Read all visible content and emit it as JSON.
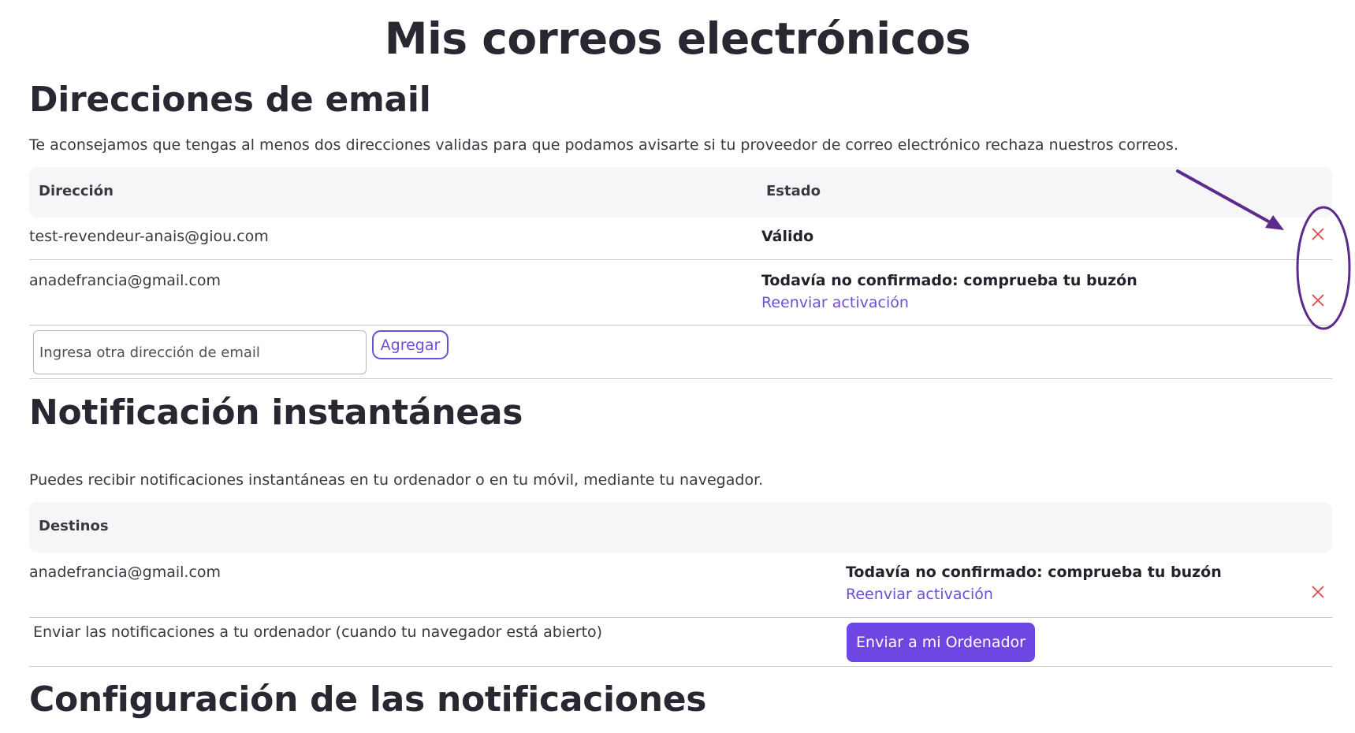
{
  "page_title": "Mis correos electrónicos",
  "emails_section": {
    "heading": "Direcciones de email",
    "description": "Te aconsejamos que tengas al menos dos direcciones validas para que podamos avisarte si tu proveedor de correo electrónico rechaza nuestros correos.",
    "columns": {
      "address": "Dirección",
      "status": "Estado"
    },
    "rows": [
      {
        "address": "test-revendeur-anais@giou.com",
        "status": "Válido"
      },
      {
        "address": "anadefrancia@gmail.com",
        "status": "Todavía no confirmado: comprueba tu buzón",
        "resend": "Reenviar activación"
      }
    ],
    "input_placeholder": "Ingresa otra dirección de email",
    "add_button": "Agregar"
  },
  "push_section": {
    "heading": "Notificación instantáneas",
    "description": "Puedes recibir notificaciones instantáneas en tu ordenador o en tu móvil, mediante tu navegador.",
    "column": "Destinos",
    "rows": [
      {
        "destination": "anadefrancia@gmail.com",
        "status": "Todavía no confirmado: comprueba tu buzón",
        "resend": "Reenviar activación"
      }
    ],
    "computer_text": "Enviar las notificaciones a tu ordenador (cuando tu navegador está abierto)",
    "computer_button": "Enviar a mi Ordenador"
  },
  "settings_section": {
    "heading": "Configuración de las notificaciones"
  },
  "icons": {
    "delete": "close-icon",
    "annotation_arrow": "arrow-icon",
    "annotation_ellipse": "ellipse-highlight"
  },
  "colors": {
    "accent": "#6e47e3",
    "link": "#6f4ed6",
    "delete": "#e0484c",
    "annotation": "#5b2a8c",
    "table_header_bg": "#f6f6f8"
  }
}
